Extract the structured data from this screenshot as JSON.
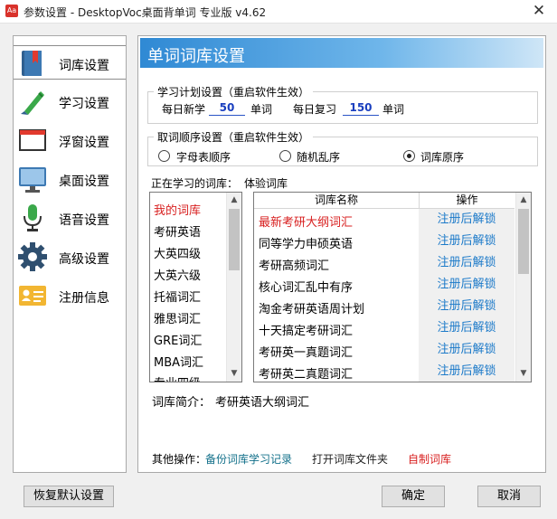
{
  "window": {
    "icon_text": "Aa",
    "title": "参数设置 - DesktopVoc桌面背单词 专业版 v4.62",
    "close_glyph": "✕"
  },
  "sidebar": {
    "items": [
      {
        "label": "词库设置",
        "icon": "vocabulary-book-icon",
        "active": true
      },
      {
        "label": "学习设置",
        "icon": "pen-icon"
      },
      {
        "label": "浮窗设置",
        "icon": "floating-window-icon"
      },
      {
        "label": "桌面设置",
        "icon": "monitor-icon"
      },
      {
        "label": "语音设置",
        "icon": "microphone-icon"
      },
      {
        "label": "高级设置",
        "icon": "gear-icon"
      },
      {
        "label": "注册信息",
        "icon": "id-card-icon"
      }
    ]
  },
  "panel": {
    "header": "单词词库设置",
    "study_plan": {
      "legend": "学习计划设置（重启软件生效）",
      "daily_new_label": "每日新学",
      "daily_new_value": "50",
      "daily_new_unit": "单词",
      "daily_review_label": "每日复习",
      "daily_review_value": "150",
      "daily_review_unit": "单词"
    },
    "order": {
      "legend": "取词顺序设置（重启软件生效）",
      "options": [
        {
          "label": "字母表顺序",
          "checked": false
        },
        {
          "label": "随机乱序",
          "checked": false
        },
        {
          "label": "词库原序",
          "checked": true
        }
      ]
    },
    "current_library_label": "正在学习的词库：",
    "current_library_value": "体验词库",
    "library_categories": [
      "我的词库",
      "考研英语",
      "大英四级",
      "大英六级",
      "托福词汇",
      "雅思词汇",
      "GRE词汇",
      "MBA词汇",
      "专业四级"
    ],
    "library_table": {
      "columns": [
        "词库名称",
        "操作"
      ],
      "rows": [
        {
          "name": "最新考研大纲词汇",
          "action": "注册后解锁",
          "highlight": true
        },
        {
          "name": "同等学力申硕英语",
          "action": "注册后解锁"
        },
        {
          "name": "考研高频词汇",
          "action": "注册后解锁"
        },
        {
          "name": "核心词汇乱中有序",
          "action": "注册后解锁"
        },
        {
          "name": "淘金考研英语周计划",
          "action": "注册后解锁"
        },
        {
          "name": "十天搞定考研词汇",
          "action": "注册后解锁"
        },
        {
          "name": "考研英一真题词汇",
          "action": "注册后解锁"
        },
        {
          "name": "考研英二真题词汇",
          "action": "注册后解锁"
        }
      ]
    },
    "intro_label": "词库简介：",
    "intro_value": "考研英语大纲词汇",
    "other_ops_label": "其他操作：",
    "other_ops": [
      "备份词库学习记录",
      "打开词库文件夹",
      "自制词库"
    ]
  },
  "footer": {
    "restore_default": "恢复默认设置",
    "ok": "确定",
    "cancel": "取消"
  },
  "colors": {
    "accent_red": "#d82020",
    "link_blue": "#1c7ac9",
    "link_teal": "#12708a",
    "header_blue": "#2f89d4"
  }
}
